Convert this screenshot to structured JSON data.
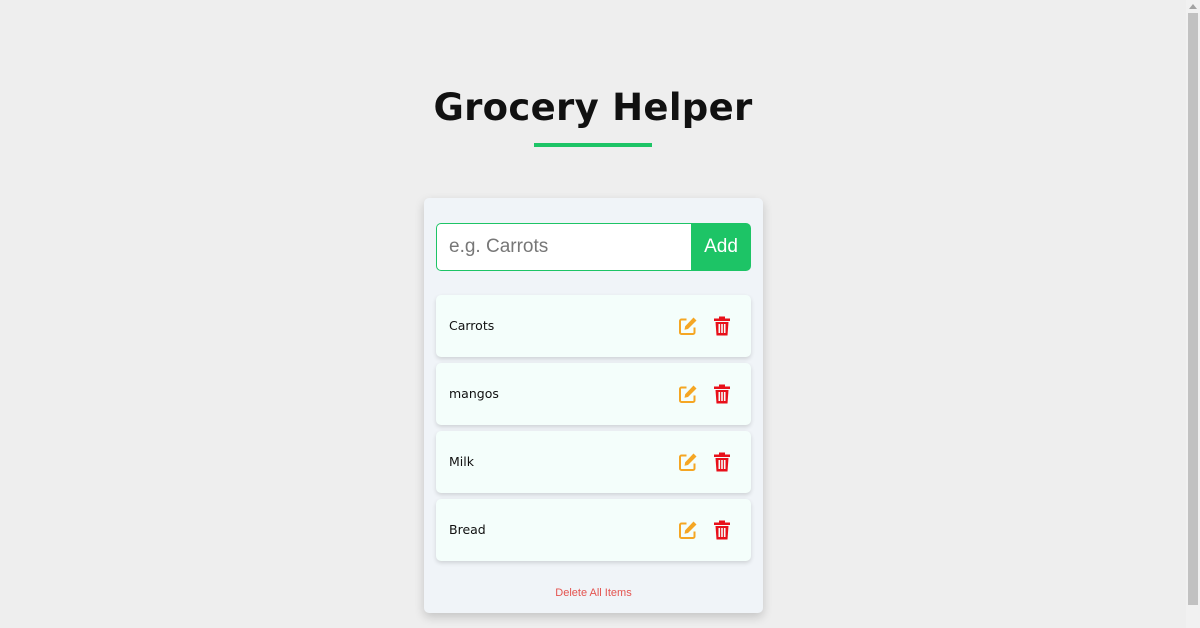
{
  "header": {
    "title": "Grocery Helper"
  },
  "form": {
    "placeholder": "e.g. Carrots",
    "value": "",
    "submit_label": "Add"
  },
  "items": [
    {
      "name": "Carrots"
    },
    {
      "name": "mangos"
    },
    {
      "name": "Milk"
    },
    {
      "name": "Bread"
    }
  ],
  "icons": {
    "edit": "edit-icon",
    "delete": "trash-icon"
  },
  "clear_label": "Delete All Items",
  "colors": {
    "accent": "#1dc466",
    "edit": "#f5a623",
    "delete": "#e8101a",
    "clear_text": "#e4534f"
  }
}
